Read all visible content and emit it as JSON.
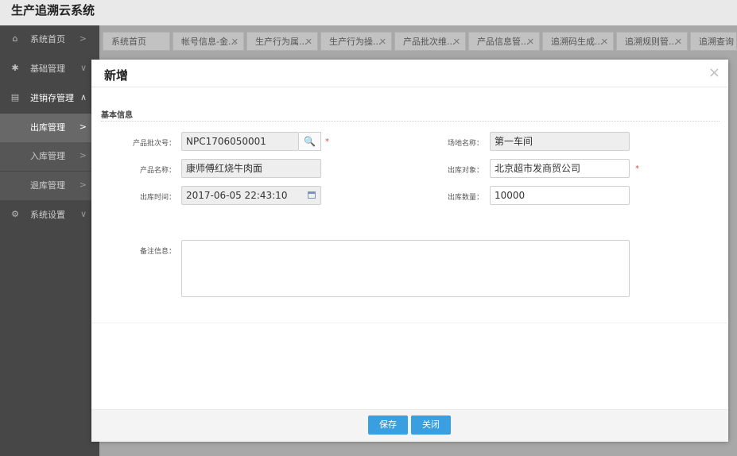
{
  "app": {
    "title": "生产追溯云系统"
  },
  "sidebar": {
    "items": [
      {
        "label": "系统首页",
        "icon": "home-icon"
      },
      {
        "label": "基础管理",
        "icon": "gear-icon"
      },
      {
        "label": "进销存管理",
        "icon": "book-icon"
      },
      {
        "label": "出库管理"
      },
      {
        "label": "入库管理"
      },
      {
        "label": "退库管理"
      },
      {
        "label": "系统设置",
        "icon": "cogs-icon"
      }
    ]
  },
  "tabs": [
    {
      "label": "系统首页"
    },
    {
      "label": "帐号信息-金..."
    },
    {
      "label": "生产行为属..."
    },
    {
      "label": "生产行为操..."
    },
    {
      "label": "产品批次维..."
    },
    {
      "label": "产品信息管..."
    },
    {
      "label": "追溯码生成..."
    },
    {
      "label": "追溯规则管..."
    },
    {
      "label": "追溯查询"
    }
  ],
  "modal": {
    "title": "新增",
    "section_title": "基本信息",
    "fields": {
      "batch_no": {
        "label": "产品批次号：",
        "value": "NPC1706050001"
      },
      "product_name": {
        "label": "产品名称：",
        "value": "康师傅红烧牛肉面"
      },
      "out_time": {
        "label": "出库时间：",
        "value": "2017-06-05 22:43:10"
      },
      "site_name": {
        "label": "场地名称：",
        "value": "第一车间"
      },
      "out_target": {
        "label": "出库对象：",
        "value": "北京超市发商贸公司"
      },
      "out_qty": {
        "label": "出库数量：",
        "value": "10000"
      },
      "remark": {
        "label": "备注信息：",
        "value": ""
      }
    },
    "required_mark": "*",
    "buttons": {
      "save": "保存",
      "close": "关闭"
    }
  },
  "colors": {
    "primary": "#3a9fe0",
    "sidebar": "#474747",
    "required": "#ee4444"
  }
}
